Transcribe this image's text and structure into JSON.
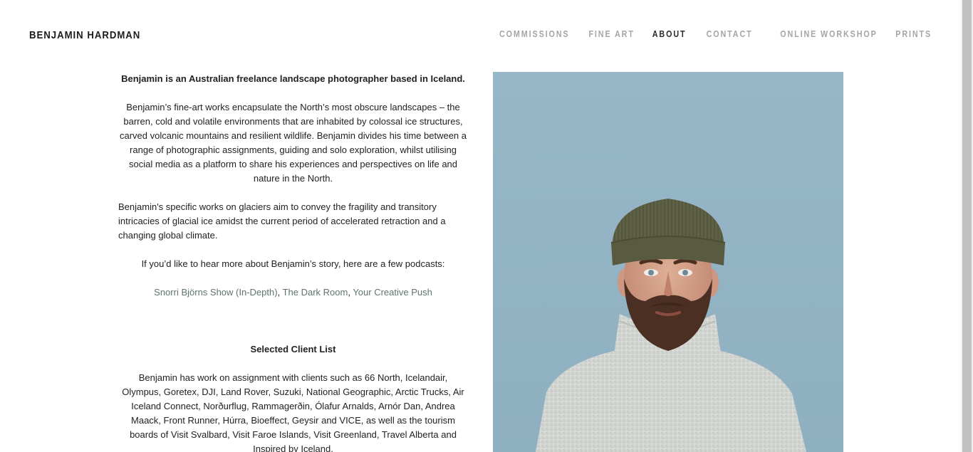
{
  "site": {
    "title": "BENJAMIN HARDMAN"
  },
  "nav": {
    "items": [
      {
        "label": "COMMISSIONS",
        "active": false
      },
      {
        "label": "FINE ART",
        "active": false
      },
      {
        "label": "ABOUT",
        "active": true
      },
      {
        "label": "CONTACT",
        "active": false
      },
      {
        "label": "ONLINE WORKSHOP",
        "active": false
      },
      {
        "label": "PRINTS",
        "active": false
      }
    ]
  },
  "about": {
    "intro": "Benjamin is an Australian freelance landscape photographer based in Iceland.",
    "paragraph1": "Benjamin’s fine-art works encapsulate the North’s most obscure landscapes – the barren, cold and volatile environments that are inhabited by colossal ice structures, carved volcanic mountains and resilient wildlife. Benjamin divides his time between a range of photographic assignments, guiding and solo exploration, whilst utilising social media as a platform to share his experiences and perspectives on life and nature in the North.",
    "paragraph2": "Benjamin's specific works on glaciers aim to convey the fragility and transitory intricacies of glacial ice amidst the current period of accelerated retraction and a changing global climate.",
    "podcast_intro": "If you’d like to hear more about Benjamin’s story, here are a few podcasts:",
    "podcasts": [
      {
        "label": "Snorri Björns Show (In-Depth)"
      },
      {
        "label": "The Dark Room"
      },
      {
        "label": "Your Creative Push"
      }
    ],
    "podcast_separator": ", ",
    "client_heading": "Selected Client List",
    "client_text": "Benjamin has work on assignment with clients such as 66 North, Icelandair, Olympus, Goretex, DJI, Land Rover, Suzuki, National Geographic, Arctic Trucks, Air Iceland Connect, Norðurflug, Rammagerðin, Ólafur Arnalds, Arnór Dan, Andrea Maack, Front Runner, Húrra, Bioeffect, Geysir and VICE, as well as the tourism boards of Visit Svalbard, Visit Faroe Islands, Visit Greenland, Travel Alberta and Inspired by Iceland."
  },
  "portrait": {
    "background": "#97b6c7",
    "beanie_color": "#5d5f44",
    "sweater_color": "#d6d8d4",
    "beard_color": "#4a2f22",
    "skin_color": "#d9a68e"
  }
}
